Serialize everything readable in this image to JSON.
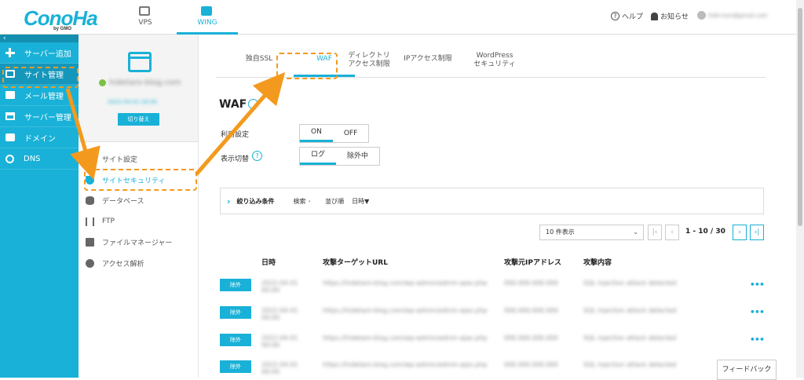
{
  "brand": {
    "logo_text": "ConoHa",
    "logo_sub": "by GMO",
    "accent": "#19b1d7",
    "highlight": "#f39a1e"
  },
  "topnav": {
    "tabs": [
      {
        "label": "VPS",
        "icon": "server-icon"
      },
      {
        "label": "WING",
        "icon": "wing-icon",
        "active": true
      }
    ],
    "help": "ヘルプ",
    "notify": "お知らせ",
    "user": "hide-taro@gmail.com"
  },
  "sidebar": {
    "collapse": "‹",
    "items": [
      {
        "label": "サーバー追加",
        "icon": "plus-icon"
      },
      {
        "label": "サイト管理",
        "icon": "browser-icon",
        "active": true
      },
      {
        "label": "メール管理",
        "icon": "mail-icon"
      },
      {
        "label": "サーバー管理",
        "icon": "server-icon"
      },
      {
        "label": "ドメイン",
        "icon": "domain-icon"
      },
      {
        "label": "DNS",
        "icon": "globe-icon"
      }
    ]
  },
  "site_panel": {
    "site_name": "hidetaro-blog.com",
    "site_date": "2022-04-01 00:00",
    "switch_label": "切り替え",
    "menu": [
      {
        "label": "サイト設定",
        "icon": "gear-icon"
      },
      {
        "label": "サイトセキュリティ",
        "icon": "shield-icon",
        "active": true
      },
      {
        "label": "データベース",
        "icon": "database-icon"
      },
      {
        "label": "FTP",
        "icon": "ftp-icon"
      },
      {
        "label": "ファイルマネージャー",
        "icon": "folder-icon"
      },
      {
        "label": "アクセス解析",
        "icon": "pie-chart-icon"
      }
    ]
  },
  "tabs": [
    {
      "label": "独自SSL"
    },
    {
      "label": "WAF",
      "active": true
    },
    {
      "label": "ディレクトリ",
      "label2": "アクセス制限"
    },
    {
      "label": "IPアクセス制限"
    },
    {
      "label": "WordPress",
      "label2": "セキュリティ"
    }
  ],
  "waf": {
    "title": "WAF",
    "use_label": "利用設定",
    "use_on": "ON",
    "use_off": "OFF",
    "display_label": "表示切替",
    "display_help": "?",
    "display_log": "ログ",
    "display_excluded": "除外中"
  },
  "filter": {
    "chevron": "›",
    "title": "絞り込み条件",
    "search": "検索 ･",
    "sort": "並び順",
    "sort_value": "日時▼"
  },
  "pager": {
    "per_page": "10 件表示",
    "select_arrow": "⌄",
    "first": "|‹",
    "prev": "‹",
    "info": "1 - 10 / 30",
    "next": "›",
    "last": "›|"
  },
  "table": {
    "headers": [
      "日時",
      "攻撃ターゲットURL",
      "攻撃元IPアドレス",
      "攻撃内容"
    ],
    "exclude_label": "除外",
    "more": "•••",
    "rows": [
      {
        "date": "2022-04-01 00:00",
        "url": "https://hidetaro-blog.com/wp-admin/admin-ajax.php",
        "ip": "000.000.000.000",
        "attack": "SQL injection attack detected"
      },
      {
        "date": "2022-04-01 00:00",
        "url": "https://hidetaro-blog.com/wp-admin/admin-ajax.php",
        "ip": "000.000.000.000",
        "attack": "SQL injection attack detected"
      },
      {
        "date": "2022-04-01 00:00",
        "url": "https://hidetaro-blog.com/wp-admin/admin-ajax.php",
        "ip": "000.000.000.000",
        "attack": "SQL injection attack detected"
      },
      {
        "date": "2022-04-01 00:00",
        "url": "https://hidetaro-blog.com/wp-admin/admin-ajax.php",
        "ip": "000.000.000.000",
        "attack": "SQL injection attack detected"
      }
    ]
  },
  "feedback": "フィードバック"
}
